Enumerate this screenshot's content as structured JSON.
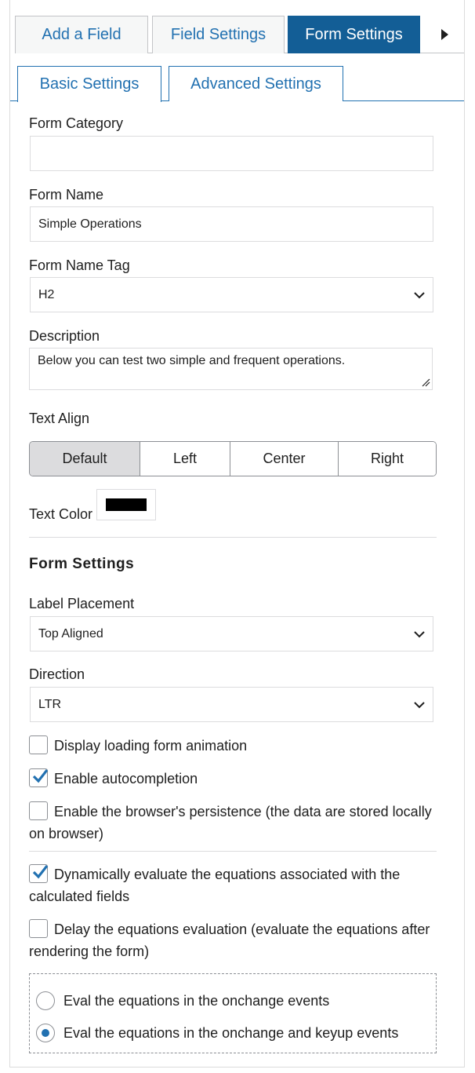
{
  "top_tabs": [
    "Add a Field",
    "Field Settings",
    "Form Settings"
  ],
  "sub_tabs": [
    "Basic Settings",
    "Advanced Settings"
  ],
  "form_category": {
    "label": "Form Category",
    "value": ""
  },
  "form_name": {
    "label": "Form Name",
    "value": "Simple Operations"
  },
  "form_name_tag": {
    "label": "Form Name Tag",
    "value": "H2"
  },
  "description": {
    "label": "Description",
    "value": "Below you can test two simple and frequent operations."
  },
  "text_align": {
    "label": "Text Align",
    "options": [
      "Default",
      "Left",
      "Center",
      "Right"
    ],
    "selected": "Default"
  },
  "text_color": {
    "label": "Text Color",
    "value": "#000000"
  },
  "form_settings": {
    "title": "Form Settings",
    "label_placement": {
      "label": "Label Placement",
      "value": "Top Aligned"
    },
    "direction": {
      "label": "Direction",
      "value": "LTR"
    },
    "checkboxes": [
      {
        "label": "Display loading form animation",
        "checked": false
      },
      {
        "label": "Enable autocompletion",
        "checked": true
      },
      {
        "label": "Enable the browser's persistence (the data are stored locally on browser)",
        "checked": false
      },
      {
        "label": "Dynamically evaluate the equations associated with the calculated fields",
        "checked": true
      },
      {
        "label": "Delay the equations evaluation (evaluate the equations after rendering the form)",
        "checked": false
      }
    ],
    "radios": [
      {
        "label": "Eval the equations in the onchange events",
        "selected": false
      },
      {
        "label": "Eval the equations in the onchange and keyup events",
        "selected": true
      }
    ]
  },
  "colors": {
    "accent": "#2271b1",
    "active_tab": "#135e96",
    "check": "#2271b1"
  }
}
